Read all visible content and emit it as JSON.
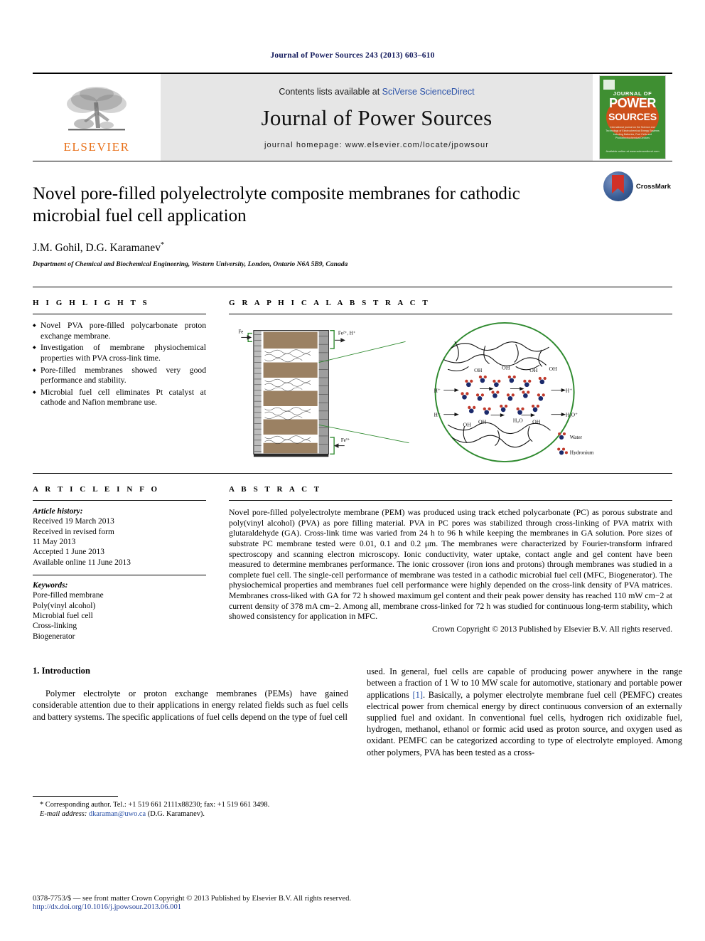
{
  "running_head": "Journal of Power Sources 243 (2013) 603–610",
  "masthead": {
    "publisher_logo_label": "ELSEVIER",
    "contents_prefix": "Contents lists available at ",
    "contents_link": "SciVerse ScienceDirect",
    "journal_title": "Journal of Power Sources",
    "homepage_line": "journal homepage: www.elsevier.com/locate/jpowsour",
    "cover": {
      "line_journal_of": "JOURNAL OF",
      "line_power": "POWER",
      "line_sources": "SOURCES",
      "subtitle": "International journal on the Science and Technology of Electrochemical Energy Systems including Batteries, Fuel Cells and Photoelectrochemical Devices",
      "bottom_note": "Available online at www.sciencedirect.com"
    }
  },
  "article": {
    "title": "Novel pore-filled polyelectrolyte composite membranes for cathodic microbial fuel cell application",
    "authors": "J.M. Gohil, D.G. Karamanev",
    "corresponding_marker": "*",
    "affiliation": "Department of Chemical and Biochemical Engineering, Western University, London, Ontario N6A 5B9, Canada",
    "crossmark_label": "CrossMark"
  },
  "highlights": {
    "heading": "H I G H L I G H T S",
    "items": [
      "Novel PVA pore-filled polycarbonate proton exchange membrane.",
      "Investigation of membrane physiochemical properties with PVA cross-link time.",
      "Pore-filled membranes showed very good performance and stability.",
      "Microbial fuel cell eliminates Pt catalyst at cathode and Nafion membrane use."
    ]
  },
  "graphical_abstract": {
    "heading": "G R A P H I C A L   A B S T R A C T",
    "labels": {
      "top_left": "Fe",
      "top_right": "Fe",
      "top_right_sup": "2+, H+",
      "bottom_right": "Fe",
      "bottom_right_sup": "3+",
      "oh": "OH",
      "h_plus": "H+",
      "h3o": "H3O+",
      "h2o": "H2O"
    },
    "legend": [
      "Water",
      "Hydronium"
    ]
  },
  "article_info": {
    "heading": "A R T I C L E   I N F O",
    "history_label": "Article history:",
    "history_lines": [
      "Received 19 March 2013",
      "Received in revised form",
      "11 May 2013",
      "Accepted 1 June 2013",
      "Available online 11 June 2013"
    ],
    "keywords_label": "Keywords:",
    "keywords": [
      "Pore-filled membrane",
      "Poly(vinyl alcohol)",
      "Microbial fuel cell",
      "Cross-linking",
      "Biogenerator"
    ]
  },
  "abstract": {
    "heading": "A B S T R A C T",
    "text": "Novel pore-filled polyelectrolyte membrane (PEM) was produced using track etched polycarbonate (PC) as porous substrate and poly(vinyl alcohol) (PVA) as pore filling material. PVA in PC pores was stabilized through cross-linking of PVA matrix with glutaraldehyde (GA). Cross-link time was varied from 24 h to 96 h while keeping the membranes in GA solution. Pore sizes of substrate PC membrane tested were 0.01, 0.1 and 0.2 μm. The membranes were characterized by Fourier-transform infrared spectroscopy and scanning electron microscopy. Ionic conductivity, water uptake, contact angle and gel content have been measured to determine membranes performance. The ionic crossover (iron ions and protons) through membranes was studied in a complete fuel cell. The single-cell performance of membrane was tested in a cathodic microbial fuel cell (MFC, Biogenerator). The physiochemical properties and membranes fuel cell performance were highly depended on the cross-link density of PVA matrices. Membranes cross-liked with GA for 72 h showed maximum gel content and their peak power density has reached 110 mW cm−2 at current density of 378 mA cm−2. Among all, membrane cross-linked for 72 h was studied for continuous long-term stability, which showed consistency for application in MFC.",
    "copyright": "Crown Copyright © 2013 Published by Elsevier B.V. All rights reserved."
  },
  "body": {
    "section_number_title": "1. Introduction",
    "left_paragraph": "Polymer electrolyte or proton exchange membranes (PEMs) have gained considerable attention due to their applications in energy related fields such as fuel cells and battery systems. The specific applications of fuel cells depend on the type of fuel cell",
    "right_paragraph_part1": "used. In general, fuel cells are capable of producing power anywhere in the range between a fraction of 1 W to 10 MW scale for automotive, stationary and portable power applications ",
    "right_reference": "[1]",
    "right_paragraph_part2": ". Basically, a polymer electrolyte membrane fuel cell (PEMFC) creates electrical power from chemical energy by direct continuous conversion of an externally supplied fuel and oxidant. In conventional fuel cells, hydrogen rich oxidizable fuel, hydrogen, methanol, ethanol or formic acid used as proton source, and oxygen used as oxidant. PEMFC can be categorized according to type of electrolyte employed. Among other polymers, PVA has been tested as a cross-"
  },
  "footnote": {
    "corresponding": "* Corresponding author. Tel.: +1 519 661 2111x88230; fax: +1 519 661 3498.",
    "email_label": "E-mail address:",
    "email": "dkaraman@uwo.ca",
    "email_owner": "(D.G. Karamanev)."
  },
  "footer": {
    "issn_line": "0378-7753/$ — see front matter Crown Copyright © 2013 Published by Elsevier B.V. All rights reserved.",
    "doi": "http://dx.doi.org/10.1016/j.jpowsour.2013.06.001"
  }
}
